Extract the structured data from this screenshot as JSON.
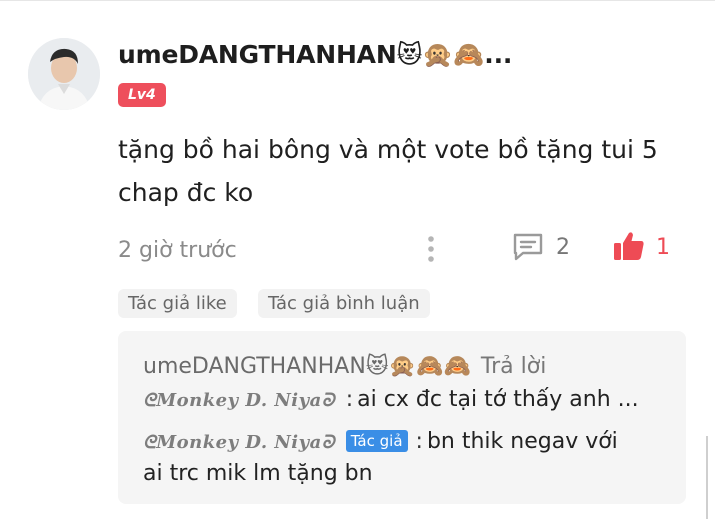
{
  "comment": {
    "username": "umeDANGTHANHAN😻🙊🙈...",
    "level": "Lv4",
    "text": "tặng bồ hai bông và một vote bồ tặng tui 5 chap đc ko",
    "timestamp": "2 giờ trước",
    "reply_count": "2",
    "like_count": "1",
    "icons": {
      "more": "more-vertical-icon",
      "reply": "comment-icon",
      "like": "thumbs-up-icon"
    },
    "colors": {
      "like": "#ee4b55",
      "level_badge": "#ee4f5c",
      "author_badge": "#3a8ee6"
    }
  },
  "tags": [
    "Tác giả like",
    "Tác giả bình luận"
  ],
  "replies": {
    "header_user": "umeDANGTHANHAN😻🙊🙈🙈",
    "reply_action": "Trả lời",
    "items": [
      {
        "author": "Monkey D. Niya",
        "badge": "",
        "text": "ai cx đc tại tớ thấy anh ..."
      },
      {
        "author": "Monkey D. Niya",
        "badge": "Tác giả",
        "text": "bn thik negav với",
        "text_line2": "ai trc mik lm tặng bn"
      }
    ]
  }
}
